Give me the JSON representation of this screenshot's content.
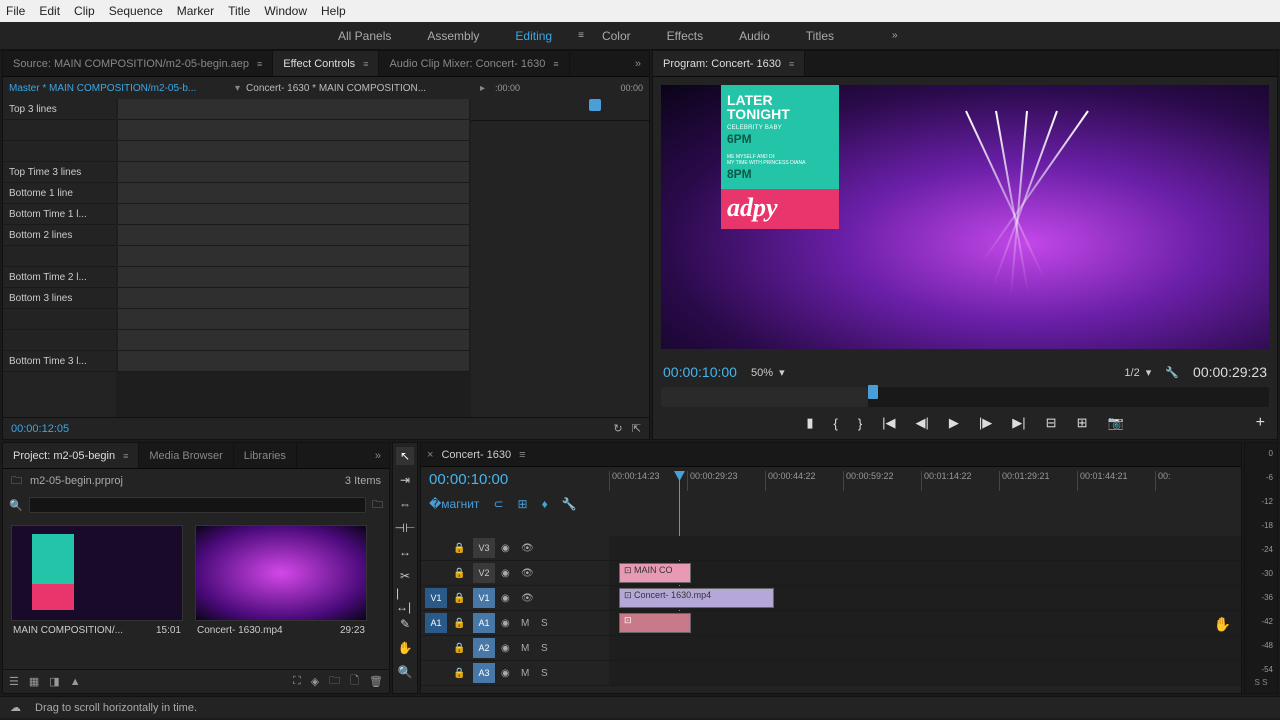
{
  "menu": {
    "items": [
      "File",
      "Edit",
      "Clip",
      "Sequence",
      "Marker",
      "Title",
      "Window",
      "Help"
    ]
  },
  "workspaces": {
    "items": [
      "All Panels",
      "Assembly",
      "Editing",
      "Color",
      "Effects",
      "Audio",
      "Titles"
    ],
    "active": "Editing"
  },
  "source_tabs": {
    "source": "Source: MAIN COMPOSITION/m2-05-begin.aep",
    "effect_controls": "Effect Controls",
    "audio_mixer": "Audio Clip Mixer: Concert- 1630"
  },
  "effect_controls": {
    "master": "Master * MAIN COMPOSITION/m2-05-b...",
    "clip": "Concert- 1630 * MAIN COMPOSITION...",
    "time_start": ":00:00",
    "time_end": "00:00",
    "props": [
      "Top 3 lines",
      "",
      "",
      "Top Time 3 lines",
      "Bottome 1 line",
      "Bottom Time 1 l...",
      "Bottom 2 lines",
      "",
      "Bottom Time 2 l...",
      "Bottom 3 lines",
      "",
      "",
      "Bottom Time 3 l..."
    ],
    "timecode": "00:00:12:05"
  },
  "program": {
    "title": "Program: Concert- 1630",
    "overlay": {
      "later": "LATER",
      "tonight": "TONIGHT",
      "sub1": "CELEBRITY BABY",
      "time1": "6PM",
      "sub2a": "ME MYSELF AND DI:",
      "sub2b": "MY TIME WITH PRINCESS DIANA",
      "time2": "8PM",
      "logo": "adpy"
    },
    "timecode": "00:00:10:00",
    "zoom": "50%",
    "res": "1/2",
    "duration": "00:00:29:23"
  },
  "project": {
    "tabs": [
      "Project: m2-05-begin",
      "Media Browser",
      "Libraries"
    ],
    "file": "m2-05-begin.prproj",
    "items": "3 Items",
    "thumbs": [
      {
        "name": "MAIN COMPOSITION/...",
        "dur": "15:01"
      },
      {
        "name": "Concert- 1630.mp4",
        "dur": "29:23"
      }
    ]
  },
  "tools": [
    "▲",
    "⇔",
    "✂",
    "⇆",
    "↔",
    "⊕",
    "✎",
    "✋",
    "🔍"
  ],
  "timeline": {
    "title": "Concert- 1630",
    "timecode": "00:00:10:00",
    "ruler": [
      "00:00:14:23",
      "00:00:29:23",
      "00:00:44:22",
      "00:00:59:22",
      "00:01:14:22",
      "00:01:29:21",
      "00:01:44:21",
      "00:"
    ],
    "clips": {
      "v2": "MAIN CO",
      "v1": "Concert- 1630.mp4"
    }
  },
  "audio_meter": {
    "scale": [
      "0",
      "-6",
      "-12",
      "-18",
      "-24",
      "-30",
      "-36",
      "-42",
      "-48",
      "-54"
    ],
    "label": "S  S"
  },
  "status": {
    "hint": "Drag to scroll horizontally in time."
  }
}
